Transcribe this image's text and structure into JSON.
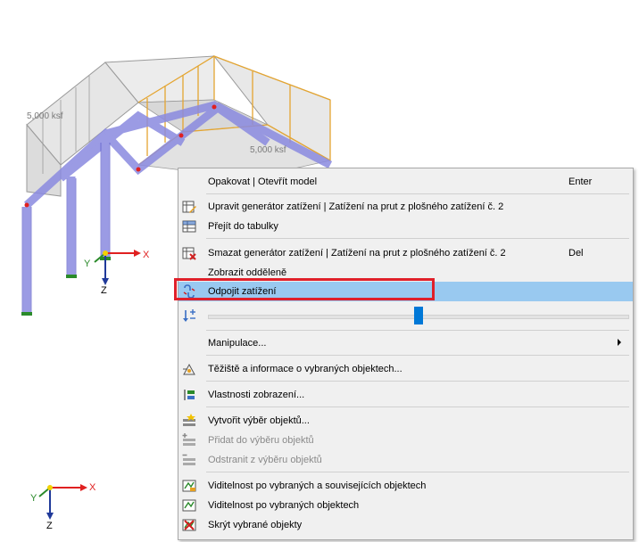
{
  "model": {
    "load_label_left": "5,000 ksf",
    "load_label_right": "5,000 ksf",
    "axis_x": "X",
    "axis_y": "Y",
    "axis_z": "Z"
  },
  "context_menu": {
    "items": [
      {
        "label": "Opakovat | Otevřít model",
        "shortcut": "Enter",
        "icon": "none"
      },
      {
        "label": "Upravit generátor zatížení | Zatížení na prut z plošného zatížení č. 2",
        "icon": "edit-generator-icon"
      },
      {
        "label": "Přejít do tabulky",
        "icon": "table-icon"
      },
      {
        "label": "Smazat generátor zatížení | Zatížení na prut z plošného zatížení č. 2",
        "shortcut": "Del",
        "icon": "delete-icon"
      },
      {
        "label": "Zobrazit odděleně",
        "icon": "none"
      },
      {
        "label": "Odpojit zatížení",
        "icon": "unlink-icon"
      },
      {
        "label": "Manipulace...",
        "icon": "none"
      },
      {
        "label": "Těžiště a informace o vybraných objektech...",
        "icon": "centroid-icon"
      },
      {
        "label": "Vlastnosti zobrazení...",
        "icon": "display-properties-icon"
      },
      {
        "label": "Vytvořit výběr objektů...",
        "icon": "create-selection-icon"
      },
      {
        "label": "Přidat do výběru objektů",
        "icon": "add-selection-icon"
      },
      {
        "label": "Odstranit z výběru objektů",
        "icon": "remove-selection-icon"
      },
      {
        "label": "Viditelnost po vybraných a souvisejících objektech",
        "icon": "visibility-related-icon"
      },
      {
        "label": "Viditelnost po vybraných objektech",
        "icon": "visibility-selected-icon"
      },
      {
        "label": "Skrýt vybrané objekty",
        "icon": "hide-objects-icon"
      }
    ],
    "slider_value": 0.5,
    "colors": {
      "highlight": "#99c9f0",
      "callout": "#e0202a",
      "slider": "#0078d7"
    }
  }
}
